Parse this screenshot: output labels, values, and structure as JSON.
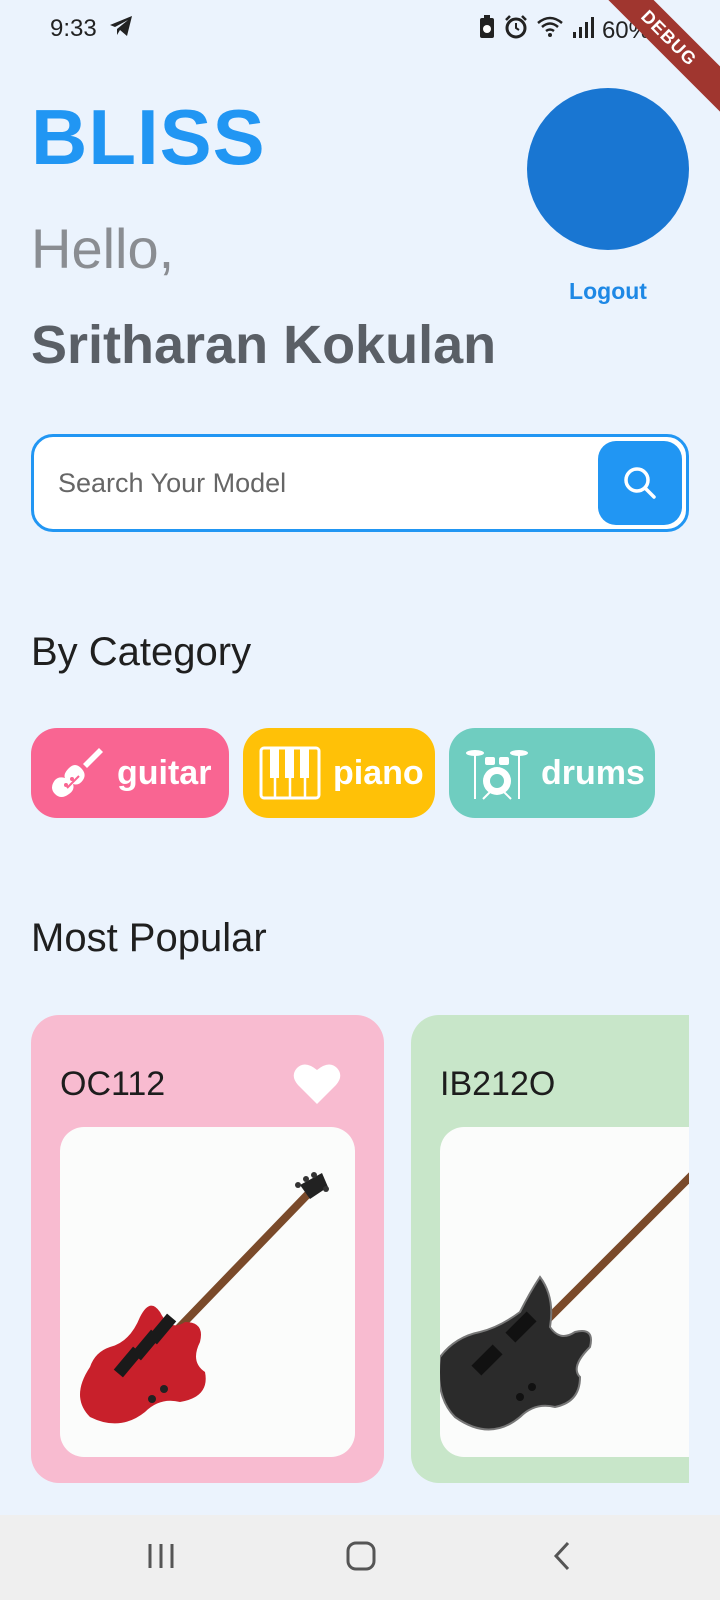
{
  "status": {
    "time": "9:33",
    "battery": "60%"
  },
  "debug": "DEBUG",
  "header": {
    "brand": "BLISS",
    "greeting": "Hello,",
    "username": "Sritharan Kokulan",
    "logout_label": "Logout"
  },
  "search": {
    "placeholder": "Search Your Model",
    "value": ""
  },
  "category": {
    "title": "By Category",
    "items": [
      {
        "label": "guitar",
        "icon": "guitar-icon",
        "color": "#f96592"
      },
      {
        "label": "piano",
        "icon": "piano-icon",
        "color": "#ffc107"
      },
      {
        "label": "drums",
        "icon": "drums-icon",
        "color": "#6fcdc0"
      }
    ]
  },
  "popular": {
    "title": "Most Popular",
    "items": [
      {
        "name": "OC112",
        "color": "#f8bbd0",
        "guitar_color": "#c8202b"
      },
      {
        "name": "IB212O",
        "color": "#c8e6c9",
        "guitar_color": "#2b2b2b"
      }
    ]
  },
  "colors": {
    "accent": "#2196f3",
    "avatar": "#1976d2",
    "background": "#ebf3fd"
  }
}
